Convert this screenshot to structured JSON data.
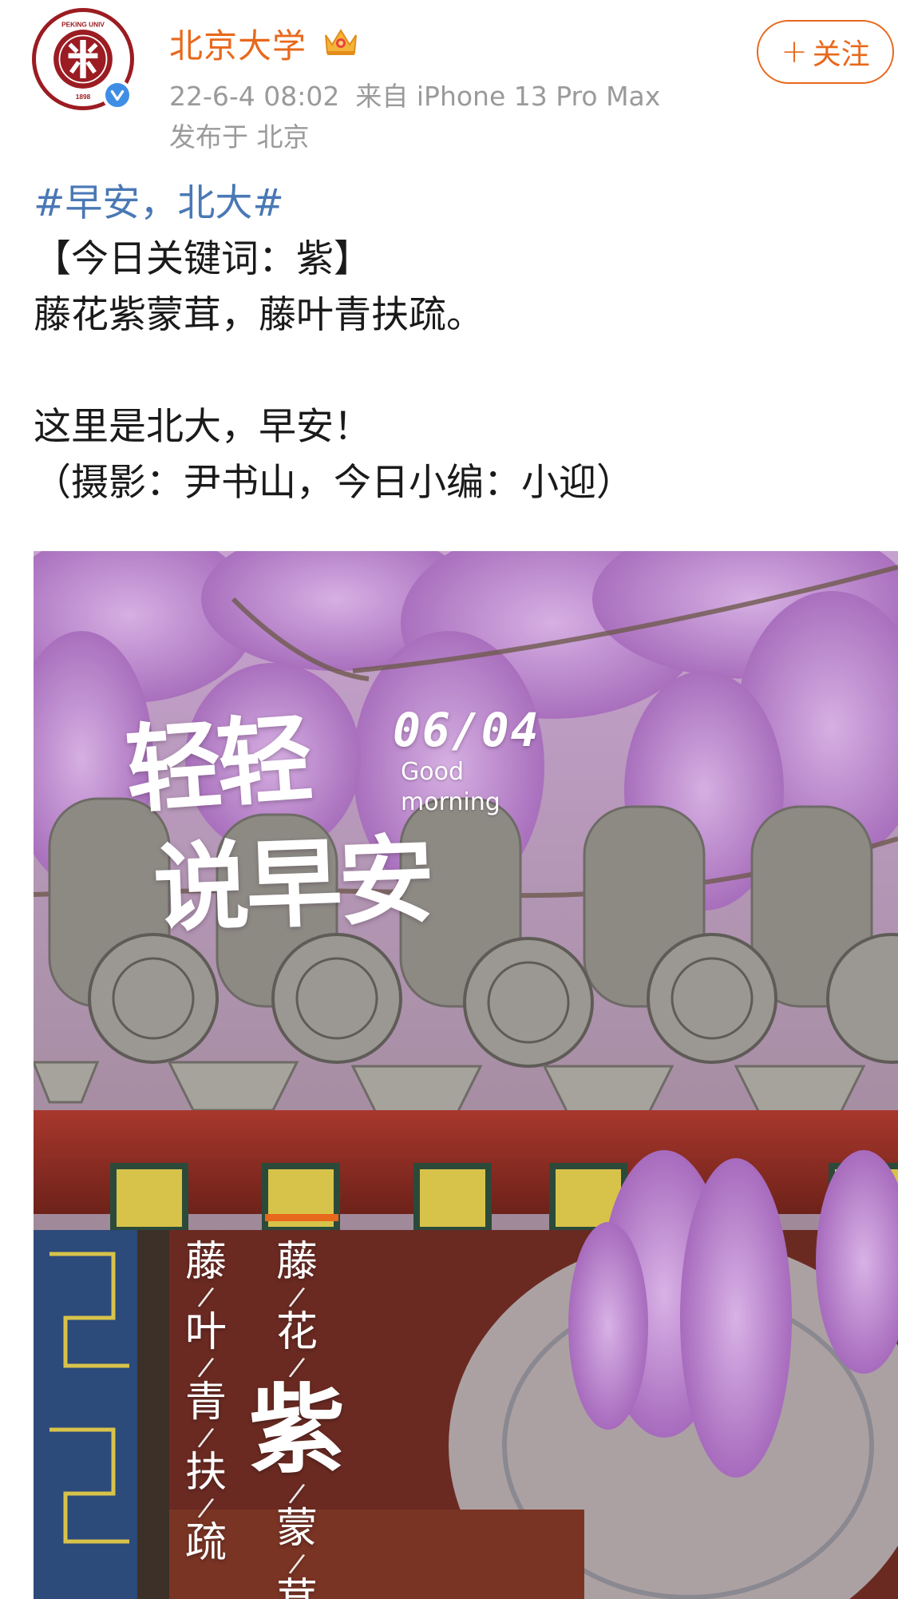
{
  "header": {
    "username": "北京大学",
    "avatar": {
      "seal_text": "PEKING UNIVERSITY",
      "seal_year": "1898",
      "seal_color": "#9b1c22"
    },
    "verified_icon": "verified-v-icon",
    "crown_icon": "crown-icon",
    "date": "22-6-4 08:02",
    "source": "来自 iPhone 13 Pro Max",
    "location": "发布于 北京",
    "follow_label": "关注"
  },
  "post": {
    "hashtag": "#早安，北大#",
    "lines": [
      "【今日关键词：紫】",
      "藤花紫蒙茸，藤叶青扶疏。",
      "",
      "这里是北大，早安！",
      "（摄影：尹书山，今日小编：小迎）"
    ]
  },
  "image": {
    "title_line1": "轻轻",
    "title_line2": "说早安",
    "date": "06/04",
    "greeting_1": "Good",
    "greeting_2": "morning",
    "left_column": [
      "藤",
      "叶",
      "青",
      "扶",
      "疏"
    ],
    "right_column_top": [
      "藤",
      "花"
    ],
    "right_column_big": "紫",
    "right_column_bottom": [
      "蒙",
      "茸"
    ]
  },
  "colors": {
    "accent_orange": "#e8681c",
    "link_blue": "#4a78b5",
    "meta_gray": "#9a9a9a"
  }
}
